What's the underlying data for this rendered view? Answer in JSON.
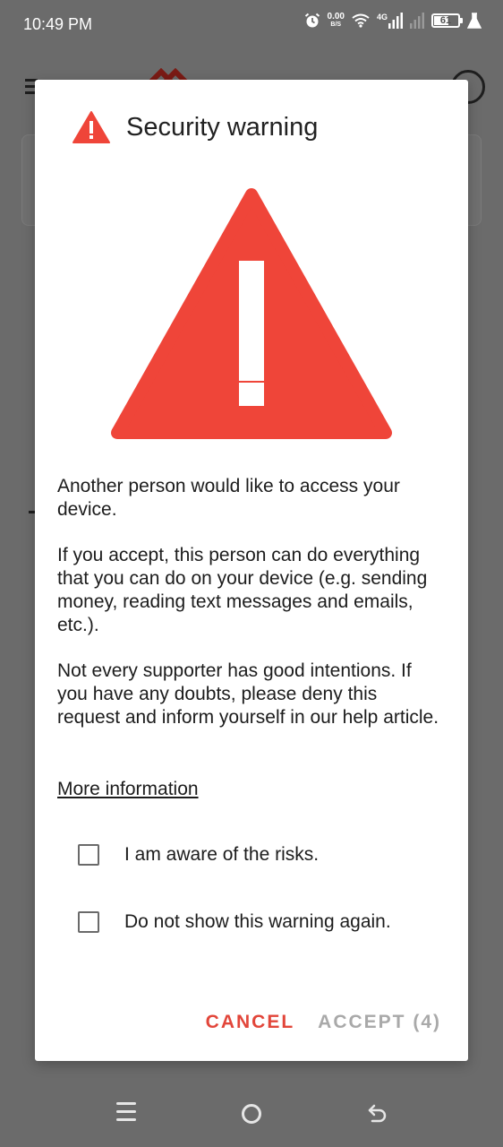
{
  "status_bar": {
    "time": "10:49 PM",
    "net_speed": "0.00",
    "net_speed_unit": "B/S",
    "network_type": "4G",
    "battery_level": "61",
    "icons": [
      "alarm-icon",
      "wifi-icon",
      "signal-icon",
      "signal-icon-2",
      "battery-icon",
      "flask-icon"
    ]
  },
  "dialog": {
    "title": "Security warning",
    "paragraphs": [
      "Another person would like to access your device.",
      "If you accept, this person can do everything that you can do on your device (e.g. sending money, reading text messages and emails, etc.).",
      "Not every supporter has good intentions. If you have any doubts, please deny this request and inform yourself in our help article."
    ],
    "more_info_link": "More information",
    "checkboxes": [
      {
        "label": "I am aware of the risks.",
        "checked": false
      },
      {
        "label": "Do not show this warning again.",
        "checked": false
      }
    ],
    "cancel_label": "CANCEL",
    "accept_label": "ACCEPT (4)",
    "accept_enabled": false
  },
  "colors": {
    "warning_red": "#ef4539",
    "cancel_red": "#e2463a",
    "disabled_gray": "#a9a9a9",
    "scrim": "#6b6b6b"
  },
  "nav_bar": {
    "icons": [
      "menu-icon",
      "home-icon",
      "back-icon"
    ]
  }
}
